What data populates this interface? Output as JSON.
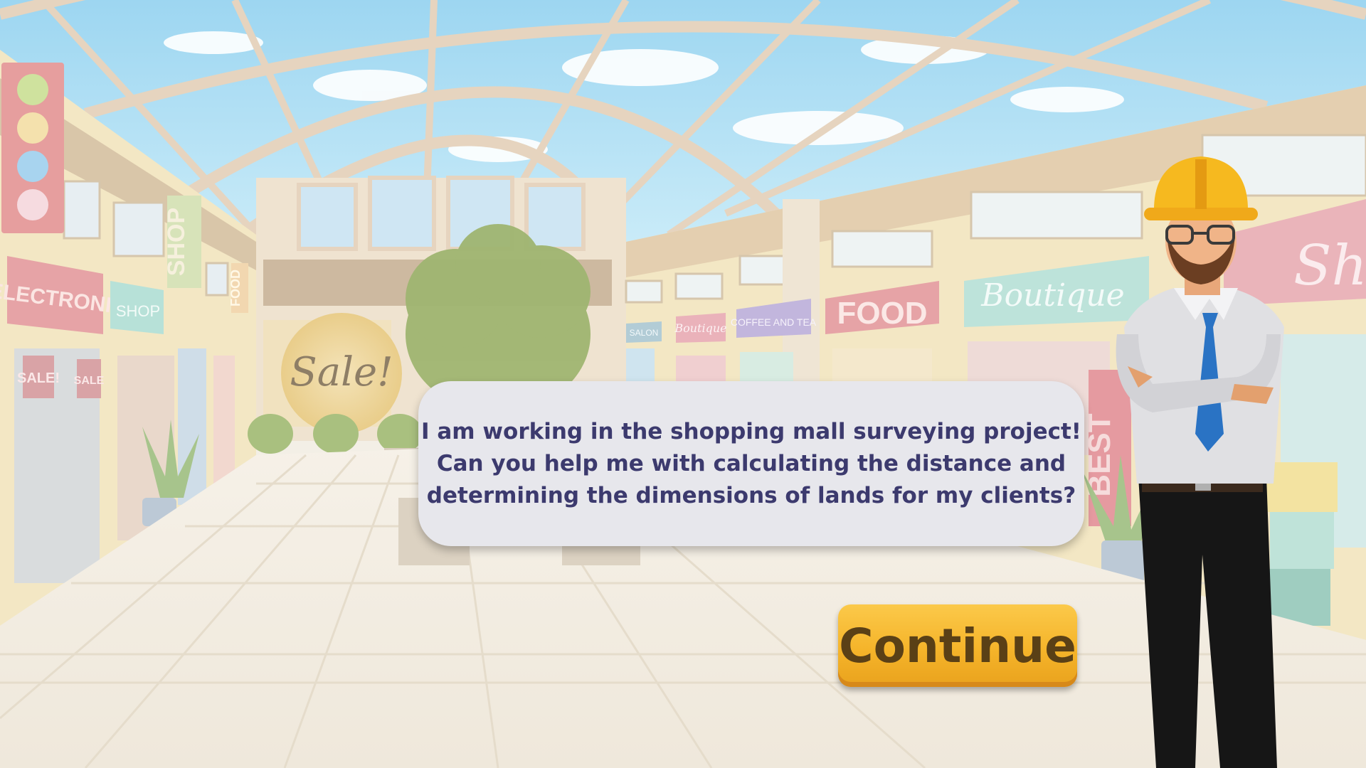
{
  "dialog": {
    "text": "I am working in the shopping mall surveying project!\nCan you help me with calculating the distance and\ndetermining the dimensions of lands for my clients?"
  },
  "continue": {
    "label": "Continue"
  },
  "signs": {
    "shop": "SHOP",
    "food_small": "FOOD",
    "electronic": "ELECTRONIC",
    "shop_small": "SHOP",
    "sale1": "SALE!",
    "sale2": "SALE",
    "sale_big": "Sale!",
    "food": "FOOD",
    "boutique": "Boutique",
    "coffee_tea": "COFFEE AND TEA",
    "salon": "SALON",
    "boutique_small": "Boutique",
    "best": "BEST",
    "shop_right": "Sh"
  },
  "colors": {
    "accent_text": "#3c3a6e",
    "button": "#f5b42a",
    "dialog_bg": "#e7e7ec"
  },
  "icons": {
    "character": "surveyor-character",
    "hard_hat": "hard-hat-icon"
  }
}
